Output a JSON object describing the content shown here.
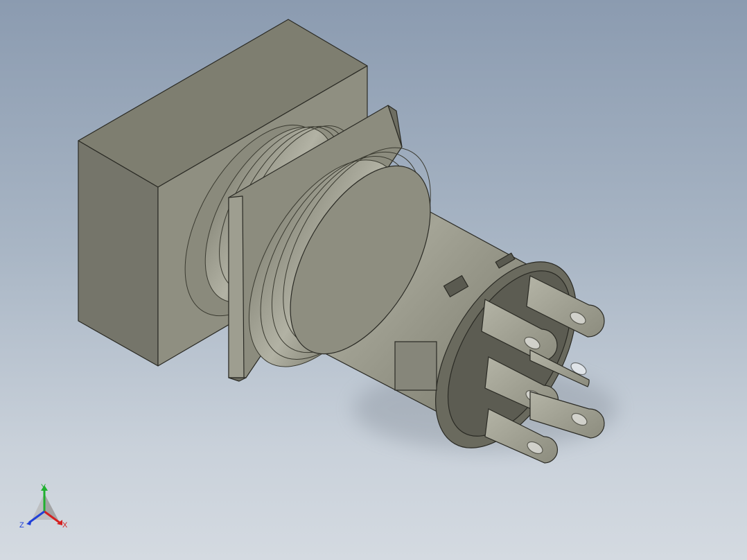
{
  "viewport": {
    "background_top": "#8b9bb0",
    "background_bottom": "#d4dae1",
    "model_color": "#8c8c7e"
  },
  "triad": {
    "x_label": "X",
    "y_label": "Y",
    "z_label": "Z",
    "x_color": "#d42020",
    "y_color": "#20b030",
    "z_color": "#2040d8"
  }
}
